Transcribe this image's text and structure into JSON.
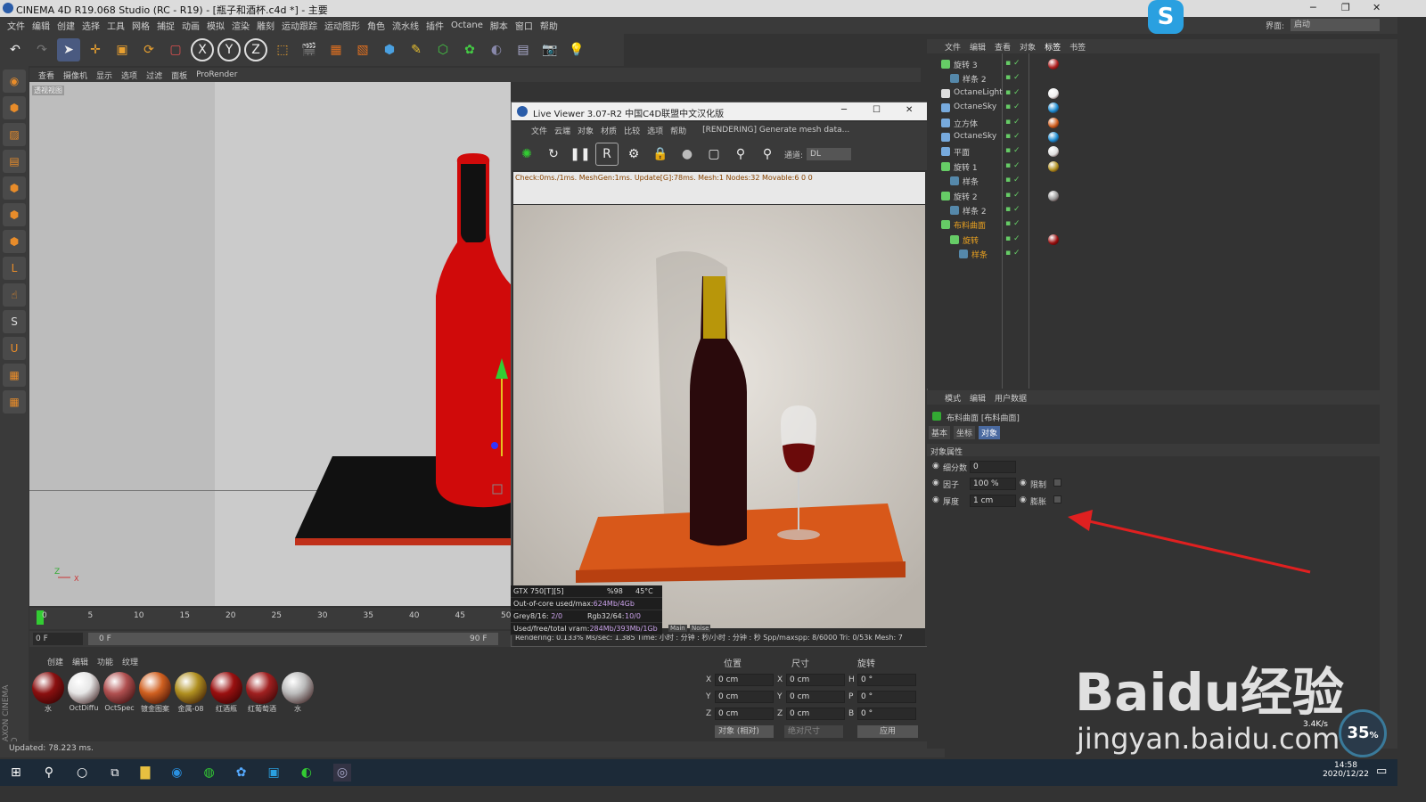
{
  "window": {
    "title": "CINEMA 4D R19.068 Studio (RC - R19) - [瓶子和酒杯.c4d *] - 主要"
  },
  "menu": [
    "文件",
    "编辑",
    "创建",
    "选择",
    "工具",
    "网格",
    "捕捉",
    "动画",
    "模拟",
    "渲染",
    "雕刻",
    "运动跟踪",
    "运动图形",
    "角色",
    "流水线",
    "插件",
    "Octane",
    "脚本",
    "窗口",
    "帮助"
  ],
  "interface": {
    "label": "界面:",
    "value": "启动"
  },
  "viewport": {
    "menu": [
      "查看",
      "摄像机",
      "显示",
      "选项",
      "过滤",
      "面板",
      "ProRender"
    ],
    "label": "透视视图"
  },
  "timeline": {
    "ticks": [
      "0",
      "5",
      "10",
      "15",
      "20",
      "25",
      "30",
      "35",
      "40",
      "45",
      "50"
    ],
    "start": "0 F",
    "current": "0 F",
    "end": "90 F"
  },
  "materials": {
    "tabs": [
      "创建",
      "编辑",
      "功能",
      "纹理"
    ],
    "items": [
      {
        "label": "水",
        "color": "#8b1010"
      },
      {
        "label": "OctDiffu",
        "color": "#e6e6e6"
      },
      {
        "label": "OctSpec",
        "color": "#b05050"
      },
      {
        "label": "镀金图案",
        "color": "#d06020"
      },
      {
        "label": "金属-08",
        "color": "#b09020"
      },
      {
        "label": "红酒瓶",
        "color": "#9a1010"
      },
      {
        "label": "红葡萄酒",
        "color": "#a02020"
      },
      {
        "label": "水",
        "color": "#bbbbbb"
      }
    ]
  },
  "coords": {
    "headers": [
      "位置",
      "尺寸",
      "旋转"
    ],
    "rows": [
      {
        "a": "X",
        "pos": "0 cm",
        "b": "X",
        "size": "0 cm",
        "c": "H",
        "rot": "0 °"
      },
      {
        "a": "Y",
        "pos": "0 cm",
        "b": "Y",
        "size": "0 cm",
        "c": "P",
        "rot": "0 °"
      },
      {
        "a": "Z",
        "pos": "0 cm",
        "b": "Z",
        "size": "0 cm",
        "c": "B",
        "rot": "0 °"
      }
    ],
    "mode": "对象 (相对)",
    "size_mode": "绝对尺寸",
    "apply": "应用"
  },
  "status": "Updated: 78.223 ms.",
  "live_viewer": {
    "title": "Live Viewer 3.07-R2 中国C4D联盟中文汉化版",
    "menu": [
      "文件",
      "云端",
      "对象",
      "材质",
      "比较",
      "选项",
      "帮助"
    ],
    "rendering": "[RENDERING] Generate mesh data...",
    "channel_label": "通道:",
    "channel": "DL",
    "info": "Check:0ms./1ms. MeshGen:1ms. Update[G]:78ms. Mesh:1 Nodes:32 Movable:6  0 0",
    "status": "Rendering: 0.133% Ms/sec: 1.385   Time: 小时 : 分钟 : 秒/小时 : 分钟 : 秒   Spp/maxspp: 8/6000   Tri: 0/53k   Mesh: 7",
    "main_tab": "Main",
    "noise_tab": "Noise"
  },
  "gpu": {
    "name": "GTX 750[T][5]",
    "usage": "%98",
    "temp": "45°C",
    "outofcore_label": "Out-of-core used/max:",
    "outofcore": "624Mb/4Gb",
    "grey_label": "Grey8/16:",
    "grey": "2/0",
    "rgb_label": "Rgb32/64:",
    "rgb": "10/0",
    "vram_label": "Used/free/total vram:",
    "vram": "284Mb/393Mb/1Gb"
  },
  "object_manager": {
    "tabs": [
      "文件",
      "编辑",
      "查看",
      "对象",
      "标签",
      "书签"
    ],
    "objects": [
      {
        "name": "旋转 3",
        "indent": 0,
        "color": "#6c6",
        "tag": "#b02020"
      },
      {
        "name": "样条 2",
        "indent": 1,
        "color": "#58a",
        "tag": ""
      },
      {
        "name": "OctaneLight",
        "indent": 0,
        "color": "#ddd",
        "tag": "#eee"
      },
      {
        "name": "OctaneSky",
        "indent": 0,
        "color": "#7ad",
        "tag": "#1a8ad0"
      },
      {
        "name": "立方体",
        "indent": 0,
        "color": "#7ad",
        "tag": "#d06020"
      },
      {
        "name": "OctaneSky",
        "indent": 0,
        "color": "#7ad",
        "tag": "#1a8ad0"
      },
      {
        "name": "平面",
        "indent": 0,
        "color": "#7ad",
        "tag": "#dddddd"
      },
      {
        "name": "旋转 1",
        "indent": 0,
        "color": "#6c6",
        "tag": "#b09020"
      },
      {
        "name": "样条",
        "indent": 1,
        "color": "#58a",
        "tag": ""
      },
      {
        "name": "旋转 2",
        "indent": 0,
        "color": "#6c6",
        "tag": "#999999"
      },
      {
        "name": "样条 2",
        "indent": 1,
        "color": "#58a",
        "tag": ""
      },
      {
        "name": "布料曲面",
        "indent": 0,
        "color": "#6c6",
        "tag": "",
        "highlight": true
      },
      {
        "name": "旋转",
        "indent": 1,
        "color": "#6c6",
        "tag": "#9a1010",
        "highlight": true
      },
      {
        "name": "样条",
        "indent": 2,
        "color": "#58a",
        "tag": "",
        "highlight": true
      }
    ]
  },
  "attributes": {
    "tabs": [
      "模式",
      "编辑",
      "用户数据"
    ],
    "object_title": "布料曲面 [布料曲面]",
    "subtabs": [
      "基本",
      "坐标",
      "对象"
    ],
    "section": "对象属性",
    "fields": [
      {
        "label": "细分数",
        "value": "0"
      },
      {
        "label": "因子",
        "value": "100 %",
        "extra": "限制"
      },
      {
        "label": "厚度",
        "value": "1 cm",
        "extra": "膨胀"
      }
    ]
  },
  "taskbar": {
    "time": "14:58",
    "date": "2020/12/22"
  },
  "watermark": {
    "brand": "Baidu经验",
    "url": "jingyan.baidu.com",
    "percent": "35",
    "net_up": "3.4",
    "net_unit": "K/s"
  }
}
